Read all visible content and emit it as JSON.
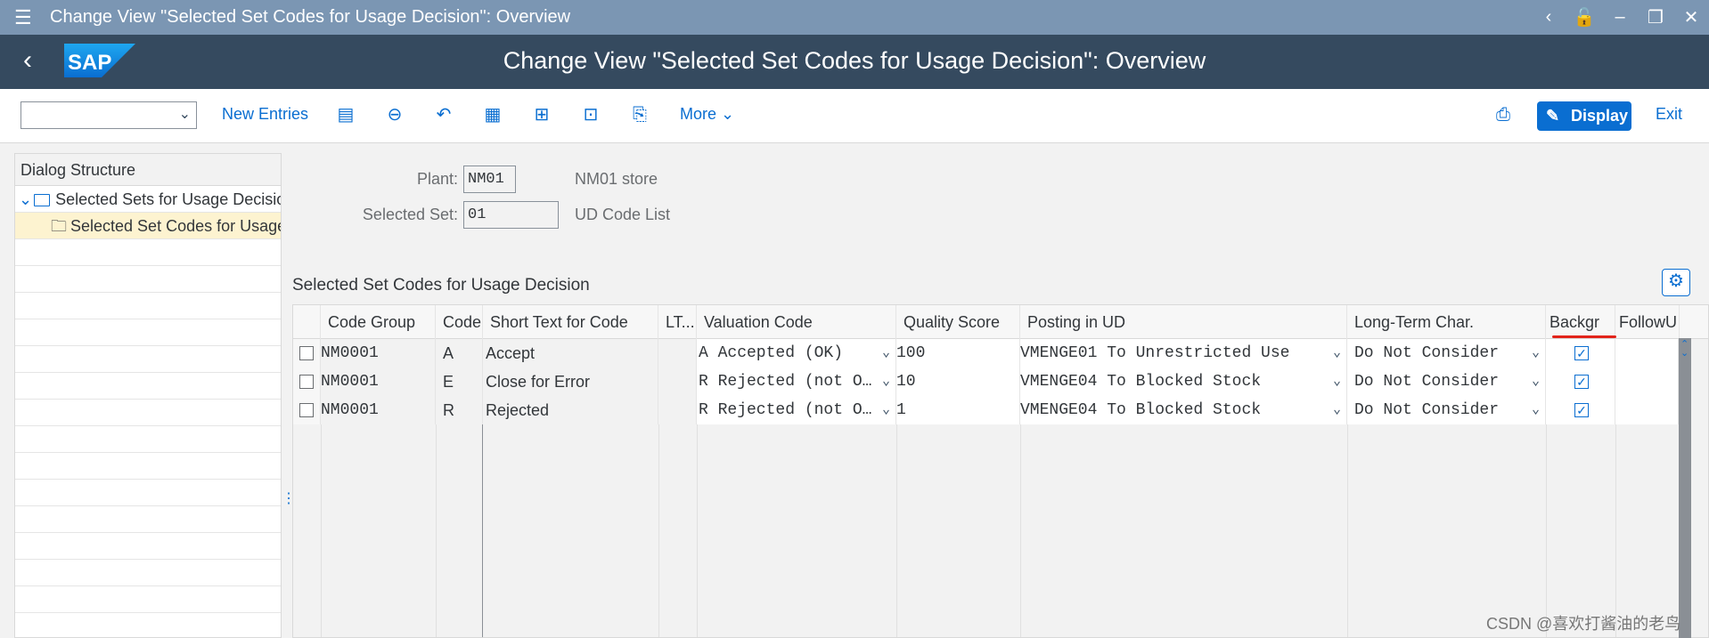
{
  "window": {
    "title": "Change View \"Selected Set Codes for Usage Decision\": Overview"
  },
  "shell": {
    "title": "Change View \"Selected Set Codes for Usage Decision\": Overview",
    "logo_text": "SAP"
  },
  "toolbar": {
    "new_entries": "New Entries",
    "more": "More",
    "display": "Display",
    "exit": "Exit"
  },
  "dialog": {
    "header": "Dialog Structure",
    "items": [
      {
        "label": "Selected Sets for Usage Decision"
      },
      {
        "label": "Selected Set Codes for Usage Decision"
      }
    ]
  },
  "form": {
    "plant_label": "Plant:",
    "plant_value": "NM01",
    "plant_desc": "NM01 store",
    "set_label": "Selected Set:",
    "set_value": "01",
    "set_desc": "UD Code List"
  },
  "section_title": "Selected Set Codes for Usage Decision",
  "table": {
    "columns": [
      "Code Group",
      "Code",
      "Short Text for Code",
      "LT...",
      "Valuation Code",
      "Quality Score",
      "Posting in UD",
      "Long-Term Char.",
      "Backgr",
      "FollowU"
    ],
    "rows": [
      {
        "code_group": "NM0001",
        "code": "A",
        "short_text": "Accept",
        "valuation": "A Accepted (OK)",
        "score": "100",
        "posting": "VMENGE01 To Unrestricted Use",
        "long_term": "Do Not Consider",
        "backgr": true
      },
      {
        "code_group": "NM0001",
        "code": "E",
        "short_text": "Close for Error",
        "valuation": "R Rejected (not O…",
        "score": "10",
        "posting": "VMENGE04 To Blocked Stock",
        "long_term": "Do Not Consider",
        "backgr": true
      },
      {
        "code_group": "NM0001",
        "code": "R",
        "short_text": "Rejected",
        "valuation": "R Rejected (not O…",
        "score": "1",
        "posting": "VMENGE04 To Blocked Stock",
        "long_term": "Do Not Consider",
        "backgr": true
      }
    ]
  },
  "watermark": "CSDN @喜欢打酱油的老鸟",
  "colors": {
    "titlebar": "#7b96b3",
    "shell": "#354a5f",
    "accent": "#0a6ed1",
    "selected_row": "#fdf3d0",
    "highlight": "#e2231a"
  }
}
